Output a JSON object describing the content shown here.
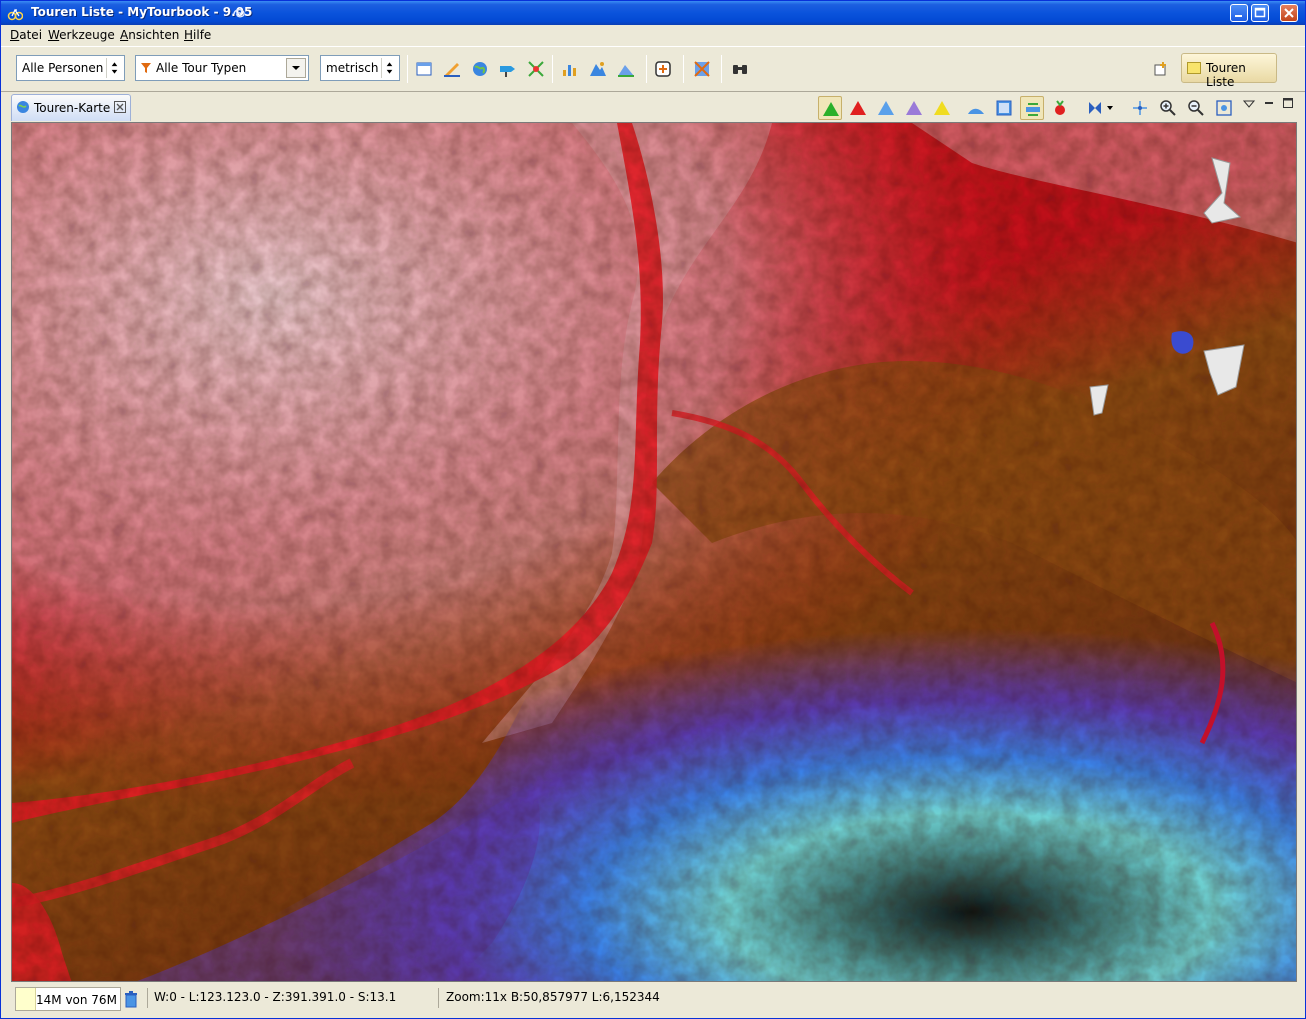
{
  "window": {
    "title": "Touren Liste - MyTourbook - 9.05"
  },
  "menu": {
    "items": [
      "Datei",
      "Werkzeuge",
      "Ansichten",
      "Hilfe"
    ]
  },
  "toolbar": {
    "person_combo": "Alle Personen",
    "tourtype_combo": "Alle Tour Typen",
    "measurement_combo": "metrisch",
    "perspective_label": "Touren Liste"
  },
  "view": {
    "tab_label": "Touren-Karte"
  },
  "map": {
    "description_icons": [
      "elevation-layer",
      "gradient-red",
      "gradient-blue",
      "gradient-purple",
      "gradient-yellow"
    ]
  },
  "status": {
    "heap": "14M von 76M",
    "position": "W:0 - L:123.123.0 - Z:391.391.0 - S:13.1",
    "zoom": "Zoom:11x  B:50,857977  L:6,152344"
  },
  "colors": {
    "accent_titlebar": "#0a53dc",
    "map_high": "#e0101a",
    "map_mid": "#8a4a12",
    "map_low": "#3b7fe6",
    "map_lowest": "#0d1a1a"
  }
}
